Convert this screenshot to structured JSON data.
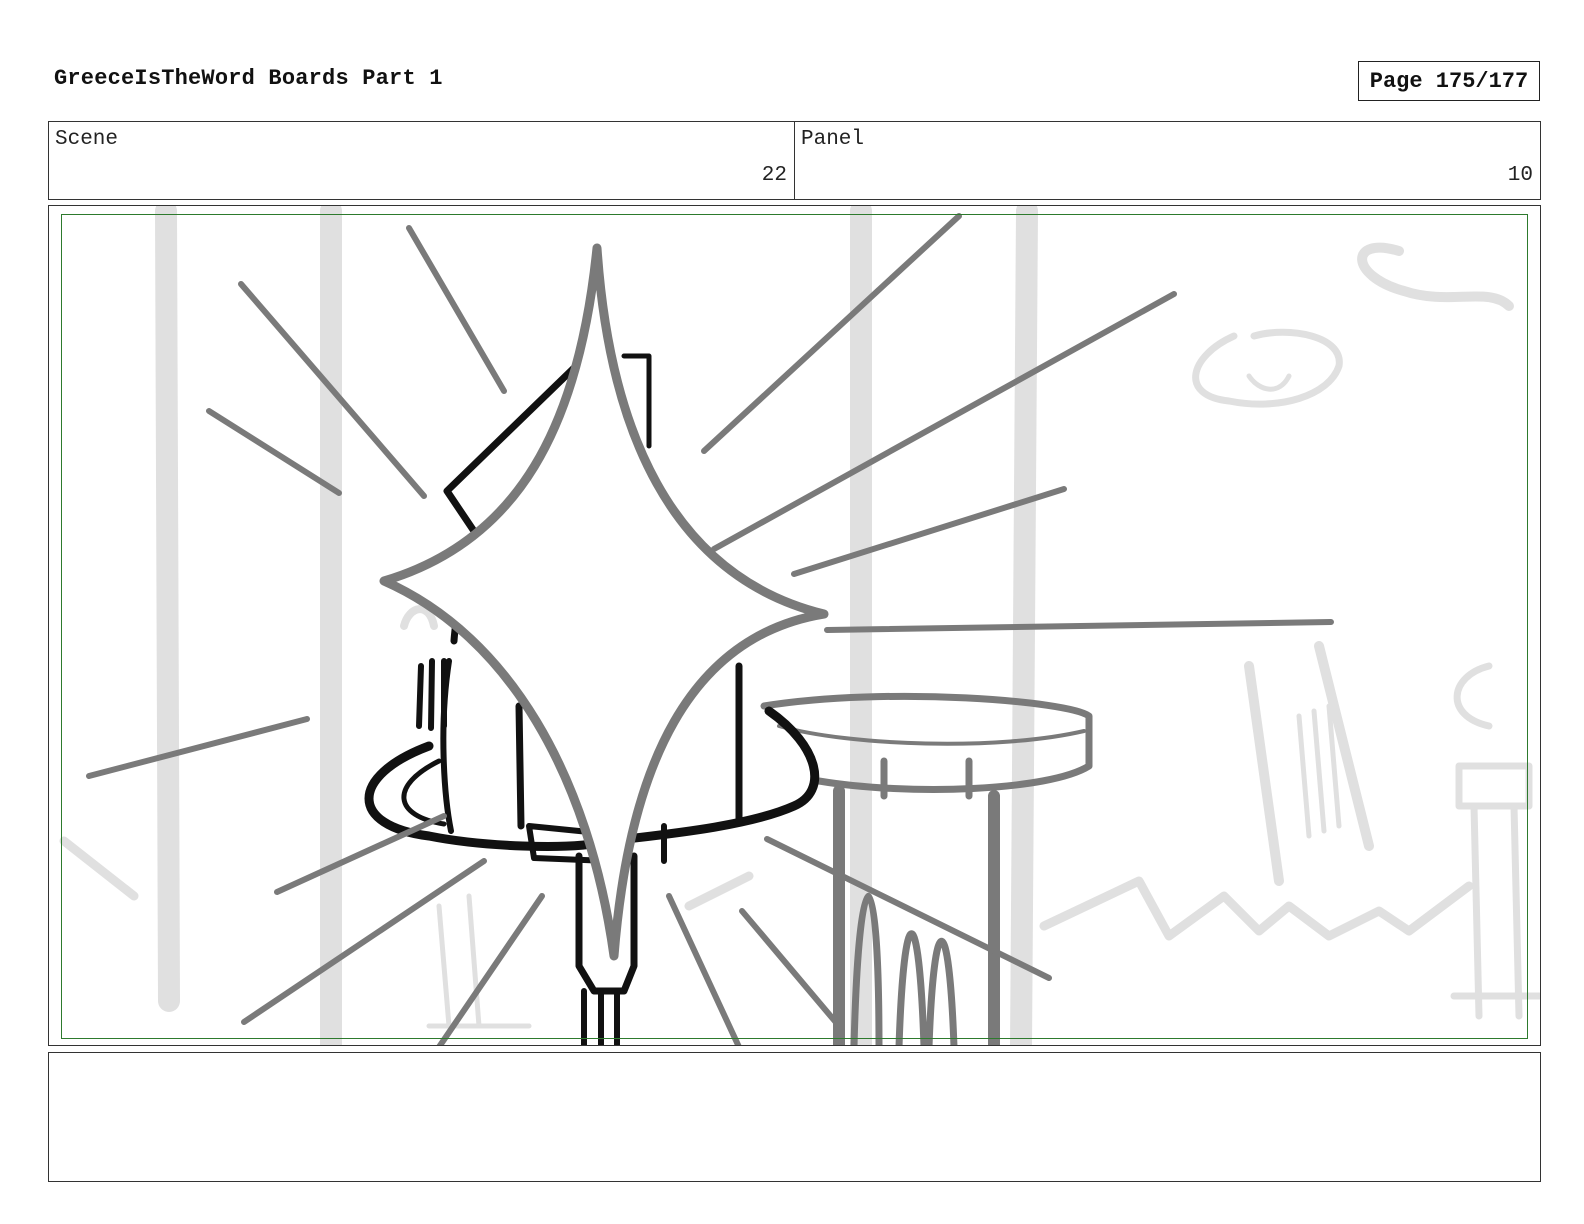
{
  "header": {
    "title": "GreeceIsTheWord Boards Part 1",
    "page": "Page 175/177"
  },
  "info": {
    "scene_label": "Scene",
    "scene_value": "22",
    "panel_label": "Panel",
    "panel_value": "10"
  },
  "notes": {
    "text": ""
  },
  "colors": {
    "safe_area": "#2d7a2d",
    "ink": "#111111",
    "pencil": "#7a7a7a",
    "background_sketch": "#e0e0e0"
  }
}
